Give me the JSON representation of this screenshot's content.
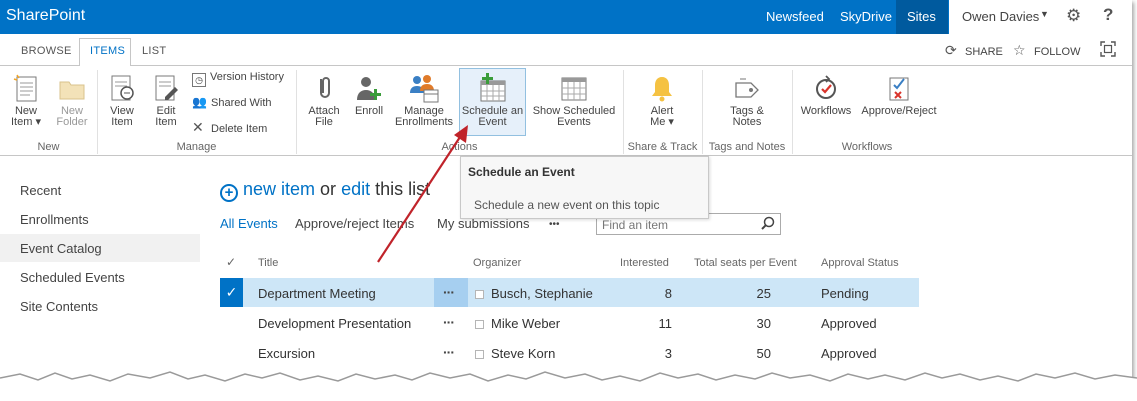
{
  "suitebar": {
    "brand": "SharePoint",
    "links": [
      "Newsfeed",
      "SkyDrive",
      "Sites"
    ],
    "user": "Owen Davies",
    "help": "?"
  },
  "ribbon_tabs": {
    "tabs": [
      "BROWSE",
      "ITEMS",
      "LIST"
    ],
    "active": "ITEMS",
    "share": "SHARE",
    "follow": "FOLLOW"
  },
  "ribbon": {
    "new_item": "New\nItem",
    "new_folder": "New\nFolder",
    "view_item": "View\nItem",
    "edit_item": "Edit\nItem",
    "version_history": "Version History",
    "shared_with": "Shared With",
    "delete_item": "Delete Item",
    "attach_file": "Attach\nFile",
    "enroll": "Enroll",
    "manage_enrollments": "Manage\nEnrollments",
    "schedule_event": "Schedule an\nEvent",
    "show_scheduled": "Show Scheduled\nEvents",
    "alert_me": "Alert\nMe",
    "tags_notes": "Tags &\nNotes",
    "workflows": "Workflows",
    "approve_reject": "Approve/Reject",
    "groups": [
      "New",
      "Manage",
      "Actions",
      "Share & Track",
      "Tags and Notes",
      "Workflows"
    ]
  },
  "tooltip": {
    "title": "Schedule an Event",
    "description": "Schedule a new event on this topic"
  },
  "left_nav": {
    "items": [
      "Recent",
      "Enrollments",
      "Event Catalog",
      "Scheduled Events",
      "Site Contents"
    ],
    "selected": "Event Catalog"
  },
  "main": {
    "new_item": "new item",
    "or": "or",
    "edit": "edit",
    "this_list": "this list",
    "views": [
      "All Events",
      "Approve/reject Items",
      "My submissions"
    ],
    "more": "•••",
    "search_placeholder": "Find an item"
  },
  "table": {
    "headers": {
      "check": "✓",
      "title": "Title",
      "organizer": "Organizer",
      "interested": "Interested",
      "seats": "Total seats per Event",
      "status": "Approval Status"
    },
    "rows": [
      {
        "title": "Department Meeting",
        "organizer": "Busch, Stephanie",
        "interested": "8",
        "seats": "25",
        "status": "Pending"
      },
      {
        "title": "Development Presentation",
        "organizer": "Mike Weber",
        "interested": "11",
        "seats": "30",
        "status": "Approved"
      },
      {
        "title": "Excursion",
        "organizer": "Steve Korn",
        "interested": "3",
        "seats": "50",
        "status": "Approved"
      }
    ],
    "selected_row": 0
  },
  "colors": {
    "suitebar": "#0072c6",
    "selected_row": "#cde6f7",
    "arrow": "#c0232a"
  }
}
